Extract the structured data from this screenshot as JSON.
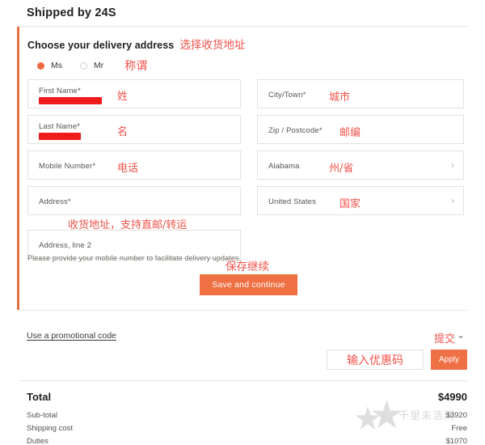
{
  "header": {
    "title": "Shipped by 24S"
  },
  "delivery": {
    "section_title": "Choose your delivery address",
    "section_title_annotation": "选择收货地址",
    "salutation": {
      "annotation": "称谓",
      "options": [
        {
          "label": "Ms",
          "selected": true
        },
        {
          "label": "Mr",
          "selected": false
        }
      ]
    },
    "fields_left": [
      {
        "label": "First Name*",
        "annotation": "姓",
        "redacted": true,
        "redact_width": 78
      },
      {
        "label": "Last Name*",
        "annotation": "名",
        "redacted": true,
        "redact_width": 52
      },
      {
        "label": "Mobile Number*",
        "annotation": "电话",
        "redacted": false
      },
      {
        "label": "Address*",
        "annotation": "",
        "redacted": false
      },
      {
        "label": "Address, line 2",
        "annotation": "",
        "redacted": false
      }
    ],
    "address_annotation": "收货地址，支持直邮/转运",
    "fields_right": [
      {
        "label": "City/Town*",
        "annotation": "城市",
        "chevron": false
      },
      {
        "label": "Zip / Postcode*",
        "annotation": "邮编",
        "chevron": false
      },
      {
        "label": "Alabama",
        "annotation": "州/省",
        "chevron": true
      },
      {
        "label": "United States",
        "annotation": "国家",
        "chevron": true
      }
    ],
    "helper_text": "Please provide your mobile number to facilitate delivery updates.",
    "cta_annotation": "保存继续",
    "cta_label": "Save and continue"
  },
  "promo": {
    "link_label": "Use a promotional code",
    "annotation": "提交",
    "chevron_icon": "⌄",
    "input_annotation": "输入优惠码",
    "input_placeholder": "",
    "apply_label": "Apply"
  },
  "totals": {
    "main_label": "Total",
    "main_value": "$4990",
    "rows": [
      {
        "label": "Sub-total",
        "value": "$3920"
      },
      {
        "label": "Shipping cost",
        "value": "Free"
      },
      {
        "label": "Duties",
        "value": "$1070"
      }
    ]
  },
  "watermark": {
    "text": "千里未浩网",
    "star_icon": "★"
  },
  "colors": {
    "accent": "#ef7043",
    "stripe": "#e2703f",
    "annotation": "#f0534a",
    "redaction": "#f01b1b",
    "text": "#23221f"
  }
}
